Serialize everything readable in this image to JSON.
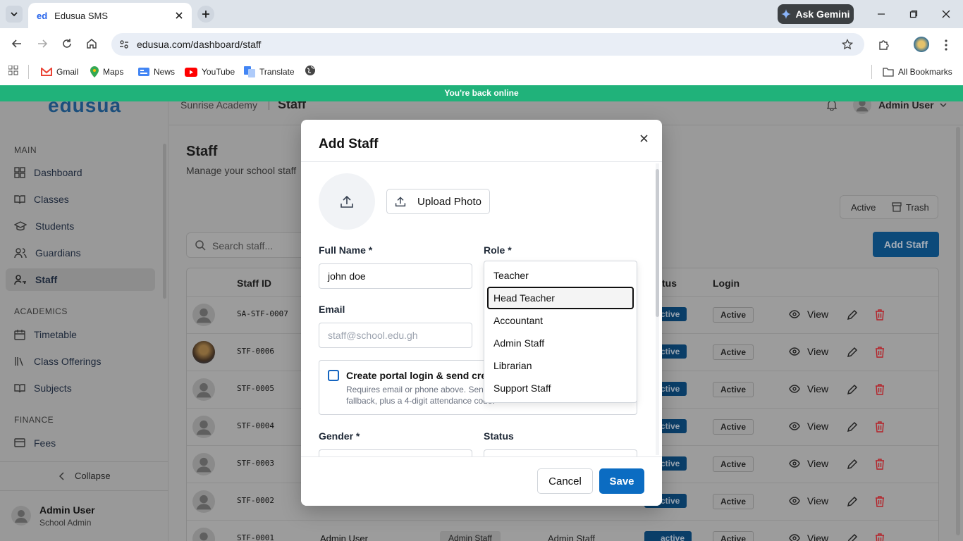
{
  "browser": {
    "tab_title": "Edusua SMS",
    "favicon_text": "ed",
    "url": "edusua.com/dashboard/staff",
    "ask_gemini": "Ask Gemini",
    "bookmarks": [
      "Gmail",
      "Maps",
      "News",
      "YouTube",
      "Translate"
    ],
    "all_bookmarks": "All Bookmarks",
    "online_banner": "You're back online"
  },
  "app": {
    "logo": "edusua",
    "school": "Sunrise Academy",
    "crumb_current": "Staff",
    "user_name": "Admin User",
    "sidebar": {
      "sections": {
        "main": "MAIN",
        "academics": "ACADEMICS",
        "finance": "FINANCE"
      },
      "items": [
        "Dashboard",
        "Classes",
        "Students",
        "Guardians",
        "Staff",
        "Timetable",
        "Class Offerings",
        "Subjects",
        "Fees"
      ],
      "collapse": "Collapse",
      "footer_name": "Admin User",
      "footer_role": "School Admin"
    },
    "page_title": "Staff",
    "page_subtitle": "Manage your school staff",
    "toggle": {
      "active": "Active",
      "trash": "Trash"
    },
    "search_placeholder": "Search staff...",
    "add_staff": "Add Staff",
    "table": {
      "headers": {
        "staff_id": "Staff ID",
        "status": "tus",
        "login": "Login"
      },
      "rows": [
        {
          "id": "SA-STF-0007",
          "status": "ctive",
          "login": "Active",
          "view": "View"
        },
        {
          "id": "STF-0006",
          "status": "ctive",
          "login": "Active",
          "view": "View"
        },
        {
          "id": "STF-0005",
          "status": "ctive",
          "login": "Active",
          "view": "View"
        },
        {
          "id": "STF-0004",
          "status": "ctive",
          "login": "Active",
          "view": "View"
        },
        {
          "id": "STF-0003",
          "status": "ctive",
          "login": "Active",
          "view": "View"
        },
        {
          "id": "STF-0002",
          "status": "ctive",
          "login": "Active",
          "view": "View"
        },
        {
          "id": "STF-0001",
          "status": "active",
          "login": "Active",
          "view": "View",
          "name": "Admin User",
          "role": "Admin Staff",
          "dept": "Admin Staff"
        }
      ]
    }
  },
  "modal": {
    "title": "Add Staff",
    "upload_photo": "Upload Photo",
    "full_name_label": "Full Name *",
    "full_name_value": "john doe",
    "role_label": "Role *",
    "email_label": "Email",
    "email_placeholder": "staff@school.edu.gh",
    "portal_label": "Create portal login & send cred",
    "portal_help_1": "Requires email or phone above. Sen",
    "portal_help_2": "fallback, plus a 4-digit attendance code.",
    "gender_label": "Gender *",
    "status_label": "Status",
    "cancel": "Cancel",
    "save": "Save",
    "role_options": [
      "Teacher",
      "Head Teacher",
      "Accountant",
      "Admin Staff",
      "Librarian",
      "Support Staff"
    ],
    "role_highlighted": "Head Teacher"
  }
}
